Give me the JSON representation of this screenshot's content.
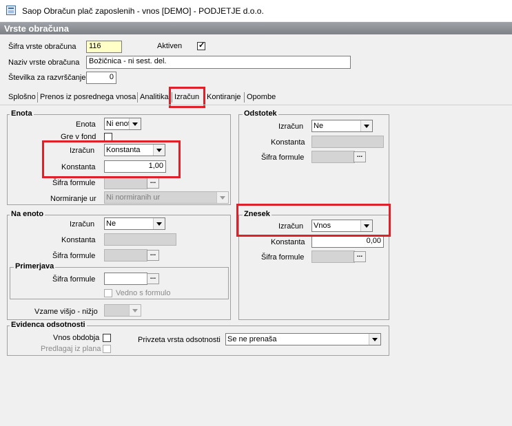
{
  "window": {
    "title": "Saop Obračun plač zaposlenih - vnos [DEMO] - PODJETJE d.o.o."
  },
  "header": {
    "title": "Vrste obračuna"
  },
  "form": {
    "sifra_label": "Šifra vrste obračuna",
    "sifra_value": "116",
    "aktiven_label": "Aktiven",
    "aktiven_checked": true,
    "naziv_label": "Naziv vrste obračuna",
    "naziv_value": "Božičnica - ni sest. del.",
    "stevilka_label": "Številka  za razvrščanje",
    "stevilka_value": "0"
  },
  "tabs": [
    {
      "label": "Splošno"
    },
    {
      "label": "Prenos iz posrednega vnosa"
    },
    {
      "label": "Analitika"
    },
    {
      "label": "Izračun",
      "active": true
    },
    {
      "label": "Kontiranje"
    },
    {
      "label": "Opombe"
    }
  ],
  "enota": {
    "title": "Enota",
    "enota_label": "Enota",
    "enota_value": "Ni enot",
    "gre_v_fond_label": "Gre v fond",
    "izracun_label": "Izračun",
    "izracun_value": "Konstanta",
    "konstanta_label": "Konstanta",
    "konstanta_value": "1,00",
    "sifra_formule_label": "Šifra formule",
    "normiranje_label": "Normiranje ur",
    "normiranje_value": "Ni normiranih ur"
  },
  "na_enoto": {
    "title": "Na enoto",
    "izracun_label": "Izračun",
    "izracun_value": "Ne",
    "konstanta_label": "Konstanta",
    "sifra_formule_label": "Šifra formule",
    "primerjava_title": "Primerjava",
    "primerjava_sifra_label": "Šifra formule",
    "vedno_label": "Vedno s formulo",
    "vzame_label": "Vzame višjo - nižjo"
  },
  "odstotek": {
    "title": "Odstotek",
    "izracun_label": "Izračun",
    "izracun_value": "Ne",
    "konstanta_label": "Konstanta",
    "sifra_formule_label": "Šifra formule"
  },
  "znesek": {
    "title": "Znesek",
    "izracun_label": "Izračun",
    "izracun_value": "Vnos",
    "konstanta_label": "Konstanta",
    "konstanta_value": "0,00",
    "sifra_formule_label": "Šifra formule"
  },
  "evidenca": {
    "title": "Evidenca odsotnosti",
    "vnos_obdobja_label": "Vnos obdobja",
    "predlagaj_label": "Predlagaj iz plana",
    "privzeta_label": "Privzeta vrsta odsotnosti",
    "privzeta_value": "Se ne prenaša"
  },
  "buttons": {
    "formula_label": "..."
  },
  "colors": {
    "highlight": "#e02028",
    "header_bg": "#8e9297",
    "code_field_bg": "#ffffc8"
  }
}
